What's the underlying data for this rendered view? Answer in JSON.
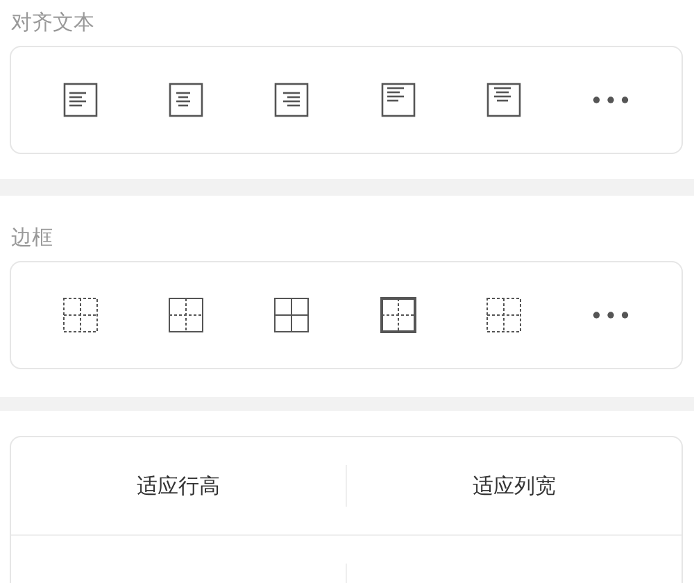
{
  "sections": [
    {
      "title": "对齐文本"
    },
    {
      "title": "边框"
    }
  ],
  "actions": [
    [
      "适应行高",
      "适应列宽"
    ]
  ]
}
